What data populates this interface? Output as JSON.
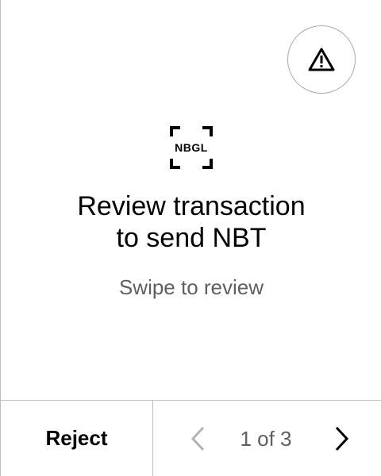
{
  "review": {
    "logo_text": "NBGL",
    "title_line1": "Review transaction",
    "title_line2": "to send NBT",
    "subtitle": "Swipe to review"
  },
  "footer": {
    "reject_label": "Reject",
    "page_indicator": "1 of 3"
  },
  "icons": {
    "warning": "warning-triangle-icon",
    "prev": "chevron-left-icon",
    "next": "chevron-right-icon",
    "logo_frame": "scan-frame-icon"
  },
  "colors": {
    "text": "#000000",
    "secondary_text": "#5f5f5f",
    "disabled_icon": "#b3b3b3",
    "divider": "#bdbdbd"
  }
}
